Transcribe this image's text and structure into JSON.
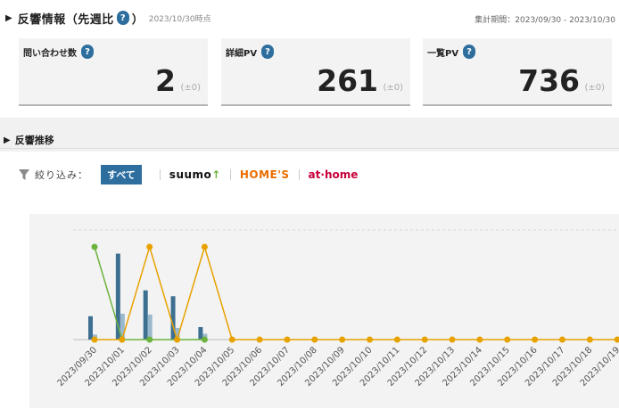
{
  "header": {
    "title": "反響情報（先週比",
    "help_symbol": "?",
    "close_paren": "）",
    "as_of": "2023/10/30時点",
    "period": "集計期間：2023/09/30 - 2023/10/30"
  },
  "cards": [
    {
      "label": "問い合わせ数",
      "value": "2",
      "diff": "(±0)"
    },
    {
      "label": "詳細PV",
      "value": "261",
      "diff": "(±0)"
    },
    {
      "label": "一覧PV",
      "value": "736",
      "diff": "(±0)"
    }
  ],
  "trend": {
    "title": "反響推移",
    "filter_label": "絞り込み：",
    "filters": {
      "all": "すべて",
      "suumo": "suumo",
      "homes": "HOME'S",
      "athome": "at·home"
    }
  },
  "colors": {
    "accent": "#2d6e9f",
    "bar_dark": "#3d6f91",
    "bar_light": "#9bb9cc",
    "line_green": "#6cb33e",
    "line_orange": "#e8a200",
    "homes": "#ec6c00",
    "athome": "#c8003b"
  },
  "chart_data": {
    "type": "bar",
    "categories": [
      "2023/09/30",
      "2023/10/01",
      "2023/10/02",
      "2023/10/03",
      "2023/10/04",
      "2023/10/05",
      "2023/10/06",
      "2023/10/07",
      "2023/10/08",
      "2023/10/09",
      "2023/10/10",
      "2023/10/11",
      "2023/10/12",
      "2023/10/13",
      "2023/10/14",
      "2023/10/15",
      "2023/10/16",
      "2023/10/17",
      "2023/10/18",
      "2023/10/19"
    ],
    "series": [
      {
        "kind": "bar",
        "color": "#3d6f91",
        "values": [
          28,
          103,
          59,
          52,
          15,
          0,
          0,
          0,
          0,
          0,
          0,
          0,
          0,
          0,
          0,
          0,
          0,
          0,
          0,
          0
        ]
      },
      {
        "kind": "bar",
        "color": "#9bb9cc",
        "values": [
          6,
          31,
          30,
          14,
          7,
          0,
          0,
          0,
          0,
          0,
          0,
          0,
          0,
          0,
          0,
          0,
          0,
          0,
          0,
          0
        ]
      },
      {
        "kind": "line",
        "color": "#6cb33e",
        "values": [
          1,
          0,
          0,
          0,
          0,
          null,
          null,
          null,
          null,
          null,
          null,
          null,
          null,
          null,
          null,
          null,
          null,
          null,
          null,
          null
        ]
      },
      {
        "kind": "line",
        "color": "#e8a200",
        "values": [
          0,
          0,
          1,
          0,
          1,
          0,
          0,
          0,
          0,
          0,
          0,
          0,
          0,
          0,
          0,
          0,
          0,
          0,
          0,
          0
        ]
      }
    ],
    "grid": true
  }
}
